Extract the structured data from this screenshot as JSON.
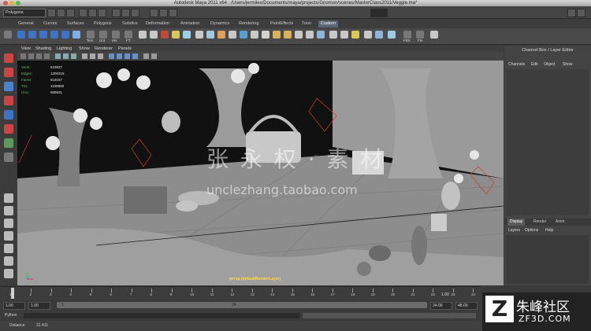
{
  "window": {
    "title": "Autodesk Maya 2011 x64 : /Users/jermilex/Documents/maya/projects/Gnomon/scenes/MasterClass2011/Veggie.ma*"
  },
  "status_line": {
    "mode": "Polygons"
  },
  "shelf": {
    "tabs": [
      "General",
      "Curves",
      "Surfaces",
      "Polygons",
      "Subdivs",
      "Deformation",
      "Animation",
      "Dynamics",
      "Rendering",
      "PaintEffects",
      "Toon",
      "Custom"
    ],
    "active_tab": "Custom",
    "icon_labels": [
      "Tem",
      "Unt",
      "His",
      "FT",
      "BDT",
      "FBX",
      "FN"
    ]
  },
  "viewport": {
    "menu": [
      "View",
      "Shading",
      "Lighting",
      "Show",
      "Renderer",
      "Panels"
    ],
    "hud": [
      {
        "label": "Verts:",
        "value": "619837"
      },
      {
        "label": "Edges:",
        "value": "1200315"
      },
      {
        "label": "Faces:",
        "value": "618167"
      },
      {
        "label": "Tris:",
        "value": "1159890"
      },
      {
        "label": "UVs:",
        "value": "689531"
      }
    ],
    "camera_label": "persp (defaultRenderLayer)",
    "watermark_cn": "张 永 权 · 素 材",
    "watermark_url": "unclezhang.taobao.com"
  },
  "channel_box": {
    "title": "Channel Box / Layer Editor",
    "menu": [
      "Channels",
      "Edit",
      "Object",
      "Show"
    ],
    "layer_tabs": [
      "Display",
      "Render",
      "Anim"
    ],
    "active_layer_tab": "Display",
    "layer_menu": [
      "Layers",
      "Options",
      "Help"
    ]
  },
  "time_slider": {
    "ticks": [
      "1",
      "2",
      "3",
      "4",
      "5",
      "6",
      "7",
      "8",
      "9",
      "10",
      "11",
      "12",
      "13",
      "14",
      "15",
      "16",
      "17",
      "18",
      "19",
      "20",
      "21",
      "22",
      "23",
      "24"
    ],
    "current_frame": "1.00"
  },
  "range": {
    "start": "1.00",
    "playback_start": "1.00",
    "slider_start": "1",
    "slider_end": "24",
    "playback_end": "24.00",
    "end": "48.00"
  },
  "command_line": {
    "label": "Python"
  },
  "help_line": {
    "label": "Distance",
    "value": "31.411"
  },
  "brand": {
    "cn": "朱峰社区",
    "en": "ZF3D.COM",
    "logo": "Z"
  },
  "colors": {
    "accent": "#5b6573",
    "hud_green": "#5cbf5c",
    "camera_label": "#ffd84a"
  }
}
